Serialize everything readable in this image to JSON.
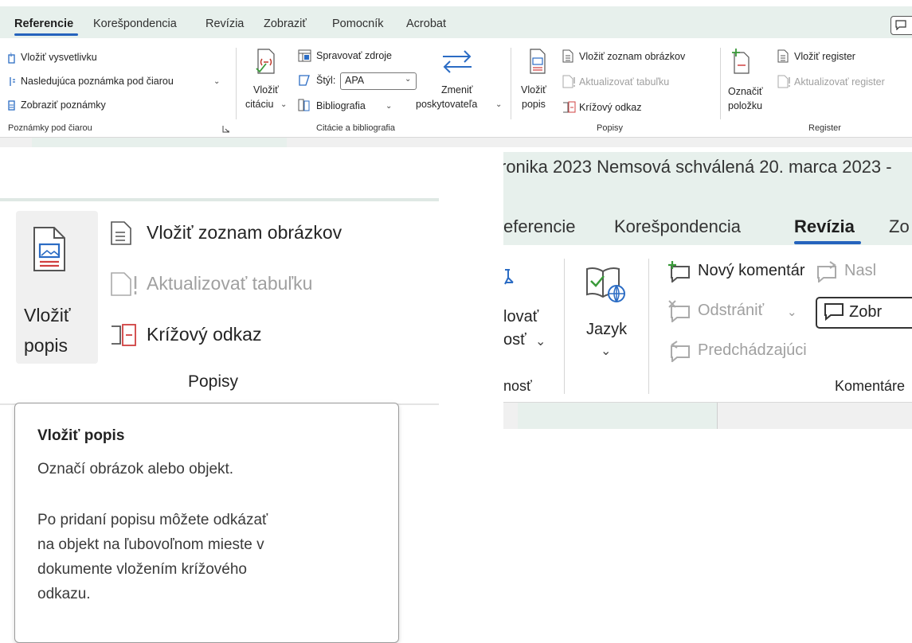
{
  "top_ribbon": {
    "tabs": [
      "Referencie",
      "Korešpondencia",
      "Revízia",
      "Zobraziť",
      "Pomocník",
      "Acrobat"
    ],
    "footnotes": {
      "insert_endnote": "Vložiť vysvetlivku",
      "next_footnote": "Nasledujúca poznámka pod čiarou",
      "show_notes": "Zobraziť poznámky",
      "group_label": "Poznámky pod čiarou"
    },
    "citations": {
      "insert_citation_line1": "Vložiť",
      "insert_citation_line2": "citáciu",
      "manage_sources": "Spravovať zdroje",
      "style_label": "Štýl:",
      "style_value": "APA",
      "bibliography": "Bibliografia",
      "change_provider_line1": "Zmeniť",
      "change_provider_line2": "poskytovateľa",
      "group_label": "Citácie a bibliografia"
    },
    "captions": {
      "insert_caption_line1": "Vložiť",
      "insert_caption_line2": "popis",
      "insert_table_of_figures": "Vložiť zoznam obrázkov",
      "update_table": "Aktualizovať tabuľku",
      "cross_reference": "Krížový odkaz",
      "group_label": "Popisy"
    },
    "index": {
      "mark_entry_line1": "Označiť",
      "mark_entry_line2": "položku",
      "insert_index": "Vložiť register",
      "update_index": "Aktualizovať register",
      "group_label": "Register"
    }
  },
  "zoom_captions": {
    "insert_caption_line1": "Vložiť",
    "insert_caption_line2": "popis",
    "insert_table_of_figures": "Vložiť zoznam obrázkov",
    "update_table": "Aktualizovať tabuľku",
    "cross_reference": "Krížový odkaz",
    "group_label": "Popisy"
  },
  "tooltip": {
    "title": "Vložiť popis",
    "line1": "Označí obrázok alebo objekt.",
    "line2": "Po pridaní popisu môžete odkázať",
    "line3": "na objekt na ľubovoľnom mieste v",
    "line4": "dokumente vložením krížového",
    "line5": "odkazu."
  },
  "zoom_review": {
    "doc_title_fragment": "ronika 2023 Nemsová schválená 20. marca 2023  -",
    "tabs": [
      "eferencie",
      "Korešpondencia",
      "Revízia",
      "Zo"
    ],
    "accessibility_line1": "lovať",
    "accessibility_line2": "osť",
    "accessibility_group": "nosť",
    "language": "Jazyk",
    "new_comment": "Nový komentár",
    "next": "Nasl",
    "delete": "Odstrániť",
    "show_comments": "Zobr",
    "previous": "Predchádzajúci",
    "comments_group": "Komentáre"
  }
}
